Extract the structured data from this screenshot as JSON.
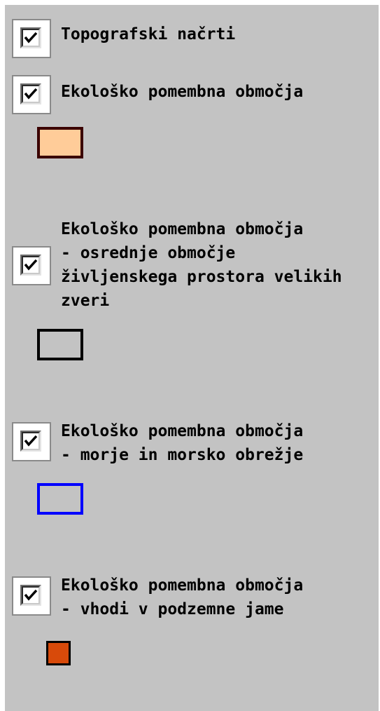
{
  "layers": [
    {
      "label_lines": [
        "Topografski načrti"
      ],
      "checked": true
    },
    {
      "label_lines": [
        "Ekološko pomembna območja"
      ],
      "checked": true,
      "legend": {
        "fill": "#ffcc99",
        "border": "#3a0000"
      }
    },
    {
      "label_lines": [
        "Ekološko pomembna območja",
        "- osrednje območje",
        "življenskega prostora velikih",
        "zveri"
      ],
      "checked": true,
      "legend": {
        "fill": "#c3c3c3",
        "border": "#000000"
      }
    },
    {
      "label_lines": [
        "Ekološko pomembna območja",
        "- morje in morsko obrežje"
      ],
      "checked": true,
      "legend": {
        "fill": "#c3c3c3",
        "border": "#0000ff"
      }
    },
    {
      "label_lines": [
        "Ekološko pomembna območja",
        "- vhodi v podzemne jame"
      ],
      "checked": true,
      "legend": {
        "fill": "#d84a0a",
        "border": "#000000"
      }
    }
  ]
}
